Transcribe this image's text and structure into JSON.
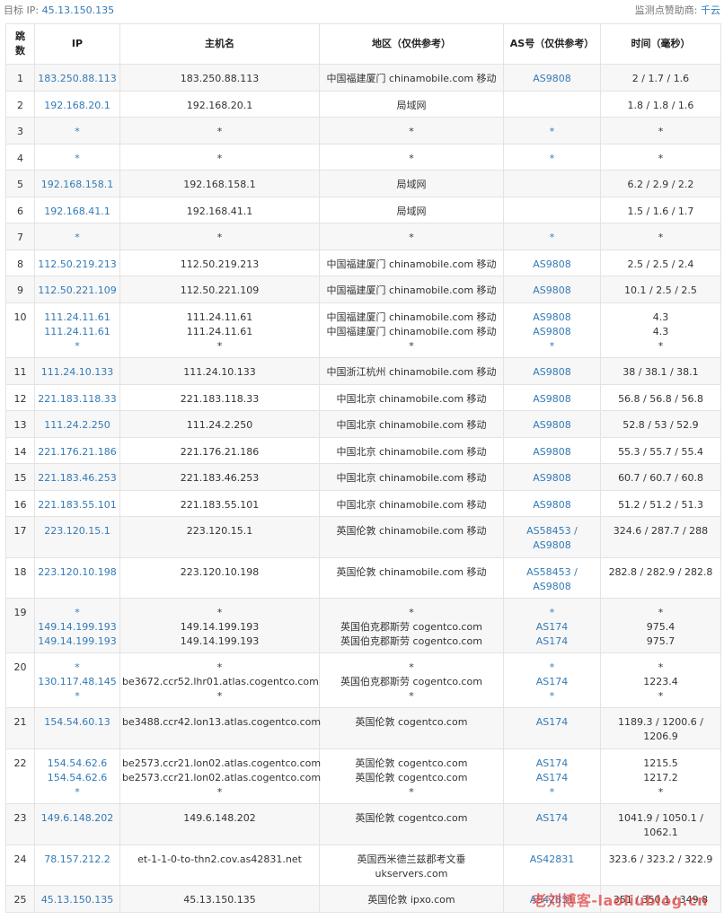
{
  "header": {
    "target_label": "目标 IP:",
    "target_ip": "45.13.150.135",
    "sponsor_label": "监测点赞助商:",
    "sponsor_name": "千云"
  },
  "table": {
    "columns": [
      "跳数",
      "IP",
      "主机名",
      "地区（仅供参考）",
      "AS号（仅供参考）",
      "时间（毫秒）"
    ],
    "rows": [
      {
        "hop": "1",
        "ip": [
          "183.250.88.113"
        ],
        "host": [
          "183.250.88.113"
        ],
        "region": [
          "中国福建厦门 chinamobile.com 移动"
        ],
        "as": [
          "AS9808"
        ],
        "time": [
          "2 / 1.7 / 1.6"
        ],
        "h": 30
      },
      {
        "hop": "2",
        "ip": [
          "192.168.20.1"
        ],
        "host": [
          "192.168.20.1"
        ],
        "region": [
          "局域网"
        ],
        "as": [
          ""
        ],
        "time": [
          "1.8 / 1.8 / 1.6"
        ],
        "h": 29
      },
      {
        "hop": "3",
        "ip": [
          "*"
        ],
        "host": [
          "*"
        ],
        "region": [
          "*"
        ],
        "as": [
          "*"
        ],
        "time": [
          "*"
        ],
        "h": 30
      },
      {
        "hop": "4",
        "ip": [
          "*"
        ],
        "host": [
          "*"
        ],
        "region": [
          "*"
        ],
        "as": [
          "*"
        ],
        "time": [
          "*"
        ],
        "h": 29
      },
      {
        "hop": "5",
        "ip": [
          "192.168.158.1"
        ],
        "host": [
          "192.168.158.1"
        ],
        "region": [
          "局域网"
        ],
        "as": [
          ""
        ],
        "time": [
          "6.2 / 2.9 / 2.2"
        ],
        "h": 30
      },
      {
        "hop": "6",
        "ip": [
          "192.168.41.1"
        ],
        "host": [
          "192.168.41.1"
        ],
        "region": [
          "局域网"
        ],
        "as": [
          ""
        ],
        "time": [
          "1.5 / 1.6 / 1.7"
        ],
        "h": 29
      },
      {
        "hop": "7",
        "ip": [
          "*"
        ],
        "host": [
          "*"
        ],
        "region": [
          "*"
        ],
        "as": [
          "*"
        ],
        "time": [
          "*"
        ],
        "h": 30
      },
      {
        "hop": "8",
        "ip": [
          "112.50.219.213"
        ],
        "host": [
          "112.50.219.213"
        ],
        "region": [
          "中国福建厦门 chinamobile.com 移动"
        ],
        "as": [
          "AS9808"
        ],
        "time": [
          "2.5 / 2.5 / 2.4"
        ],
        "h": 29
      },
      {
        "hop": "9",
        "ip": [
          "112.50.221.109"
        ],
        "host": [
          "112.50.221.109"
        ],
        "region": [
          "中国福建厦门 chinamobile.com 移动"
        ],
        "as": [
          "AS9808"
        ],
        "time": [
          "10.1 / 2.5 / 2.5"
        ],
        "h": 30
      },
      {
        "hop": "10",
        "ip": [
          "111.24.11.61",
          "111.24.11.61",
          "*"
        ],
        "host": [
          "111.24.11.61",
          "111.24.11.61",
          "*"
        ],
        "region": [
          "中国福建厦门 chinamobile.com 移动",
          "中国福建厦门 chinamobile.com 移动",
          "*"
        ],
        "as": [
          "AS9808",
          "AS9808",
          "*"
        ],
        "time": [
          "4.3",
          "4.3",
          "*"
        ],
        "h": 61
      },
      {
        "hop": "11",
        "ip": [
          "111.24.10.133"
        ],
        "host": [
          "111.24.10.133"
        ],
        "region": [
          "中国浙江杭州 chinamobile.com 移动"
        ],
        "as": [
          "AS9808"
        ],
        "time": [
          "38 / 38.1 / 38.1"
        ],
        "h": 30
      },
      {
        "hop": "12",
        "ip": [
          "221.183.118.33"
        ],
        "host": [
          "221.183.118.33"
        ],
        "region": [
          "中国北京 chinamobile.com 移动"
        ],
        "as": [
          "AS9808"
        ],
        "time": [
          "56.8 / 56.8 / 56.8"
        ],
        "h": 29
      },
      {
        "hop": "13",
        "ip": [
          "111.24.2.250"
        ],
        "host": [
          "111.24.2.250"
        ],
        "region": [
          "中国北京 chinamobile.com 移动"
        ],
        "as": [
          "AS9808"
        ],
        "time": [
          "52.8 / 53 / 52.9"
        ],
        "h": 30
      },
      {
        "hop": "14",
        "ip": [
          "221.176.21.186"
        ],
        "host": [
          "221.176.21.186"
        ],
        "region": [
          "中国北京 chinamobile.com 移动"
        ],
        "as": [
          "AS9808"
        ],
        "time": [
          "55.3 / 55.7 / 55.4"
        ],
        "h": 29
      },
      {
        "hop": "15",
        "ip": [
          "221.183.46.253"
        ],
        "host": [
          "221.183.46.253"
        ],
        "region": [
          "中国北京 chinamobile.com 移动"
        ],
        "as": [
          "AS9808"
        ],
        "time": [
          "60.7 / 60.7 / 60.8"
        ],
        "h": 30
      },
      {
        "hop": "16",
        "ip": [
          "221.183.55.101"
        ],
        "host": [
          "221.183.55.101"
        ],
        "region": [
          "中国北京 chinamobile.com 移动"
        ],
        "as": [
          "AS9808"
        ],
        "time": [
          "51.2 / 51.2 / 51.3"
        ],
        "h": 29
      },
      {
        "hop": "17",
        "ip": [
          "223.120.15.1"
        ],
        "host": [
          "223.120.15.1"
        ],
        "region": [
          "英国伦敦 chinamobile.com 移动"
        ],
        "as": [
          "AS58453 /",
          "AS9808"
        ],
        "time": [
          "324.6 / 287.7 / 288"
        ],
        "h": 46
      },
      {
        "hop": "18",
        "ip": [
          "223.120.10.198"
        ],
        "host": [
          "223.120.10.198"
        ],
        "region": [
          "英国伦敦 chinamobile.com 移动"
        ],
        "as": [
          "AS58453 /",
          "AS9808"
        ],
        "time": [
          "282.8 / 282.9 / 282.8"
        ],
        "h": 45
      },
      {
        "hop": "19",
        "ip": [
          "*",
          "149.14.199.193",
          "149.14.199.193"
        ],
        "host": [
          "*",
          "149.14.199.193",
          "149.14.199.193"
        ],
        "region": [
          "*",
          "英国伯克郡斯劳 cogentco.com",
          "英国伯克郡斯劳 cogentco.com"
        ],
        "as": [
          "*",
          "AS174",
          "AS174"
        ],
        "time": [
          "*",
          "975.4",
          "975.7"
        ],
        "h": 61
      },
      {
        "hop": "20",
        "ip": [
          "*",
          "130.117.48.145",
          "*"
        ],
        "host": [
          "*",
          "be3672.ccr52.lhr01.atlas.cogentco.com",
          "*"
        ],
        "region": [
          "*",
          "英国伯克郡斯劳 cogentco.com",
          "*"
        ],
        "as": [
          "*",
          "AS174",
          "*"
        ],
        "time": [
          "*",
          "1223.4",
          "*"
        ],
        "h": 61
      },
      {
        "hop": "21",
        "ip": [
          "154.54.60.13"
        ],
        "host": [
          "be3488.ccr42.lon13.atlas.cogentco.com"
        ],
        "region": [
          "英国伦敦 cogentco.com"
        ],
        "as": [
          "AS174"
        ],
        "time": [
          "1189.3 / 1200.6 /",
          "1206.9"
        ],
        "h": 46
      },
      {
        "hop": "22",
        "ip": [
          "154.54.62.6",
          "154.54.62.6",
          "*"
        ],
        "host": [
          "be2573.ccr21.lon02.atlas.cogentco.com",
          "be2573.ccr21.lon02.atlas.cogentco.com",
          "*"
        ],
        "region": [
          "英国伦敦 cogentco.com",
          "英国伦敦 cogentco.com",
          "*"
        ],
        "as": [
          "AS174",
          "AS174",
          "*"
        ],
        "time": [
          "1215.5",
          "1217.2",
          "*"
        ],
        "h": 61
      },
      {
        "hop": "23",
        "ip": [
          "149.6.148.202"
        ],
        "host": [
          "149.6.148.202"
        ],
        "region": [
          "英国伦敦 cogentco.com"
        ],
        "as": [
          "AS174"
        ],
        "time": [
          "1041.9 / 1050.1 /",
          "1062.1"
        ],
        "h": 46
      },
      {
        "hop": "24",
        "ip": [
          "78.157.212.2"
        ],
        "host": [
          "et-1-1-0-to-thn2.cov.as42831.net"
        ],
        "region": [
          "英国西米德兰兹郡考文垂",
          "ukservers.com"
        ],
        "as": [
          "AS42831"
        ],
        "time": [
          "323.6 / 323.2 / 322.9"
        ],
        "h": 45
      },
      {
        "hop": "25",
        "ip": [
          "45.13.150.135"
        ],
        "host": [
          "45.13.150.135"
        ],
        "region": [
          "英国伦敦 ipxo.com"
        ],
        "as": [
          "AS42831"
        ],
        "time": [
          "351 / 350.1 / 349.8"
        ],
        "h": 30
      }
    ]
  },
  "watermark": "老刘博客-laoliublog.cn"
}
